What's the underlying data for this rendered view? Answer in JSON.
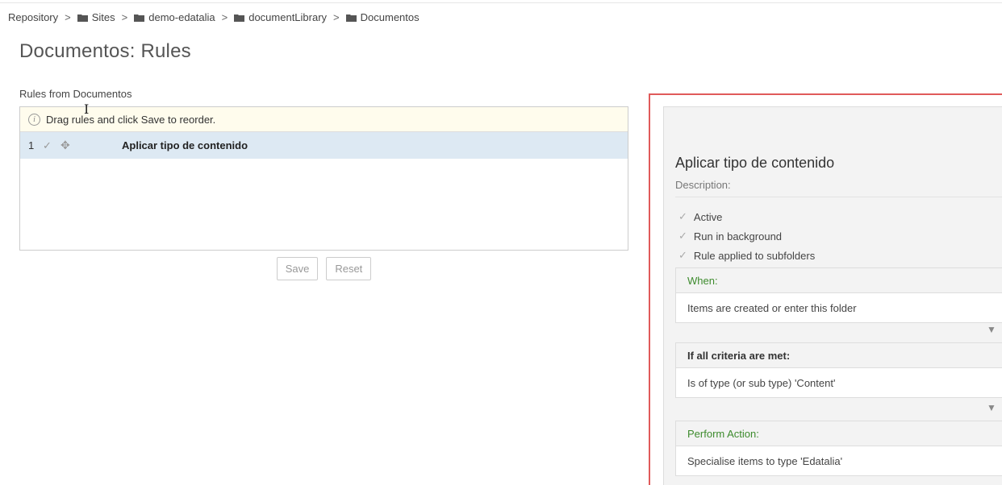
{
  "breadcrumb": {
    "root": "Repository",
    "separator": ">",
    "items": [
      "Sites",
      "demo-edatalia",
      "documentLibrary",
      "Documentos"
    ]
  },
  "page_title": "Documentos: Rules",
  "rules_list": {
    "heading": "Rules from Documentos",
    "hint": "Drag rules and click Save to reorder.",
    "rows": [
      {
        "index": "1",
        "name": "Aplicar tipo de contenido"
      }
    ],
    "save_label": "Save",
    "reset_label": "Reset"
  },
  "rule_detail": {
    "title": "Aplicar tipo de contenido",
    "description_label": "Description:",
    "flags": [
      "Active",
      "Run in background",
      "Rule applied to subfolders"
    ],
    "when_label": "When:",
    "when_value": "Items are created or enter this folder",
    "criteria_label": "If all criteria are met:",
    "criteria_value": "Is of type (or sub type) 'Content'",
    "action_label": "Perform Action:",
    "action_value": "Specialise items to type 'Edatalia'"
  },
  "colors": {
    "selected_row": "#dde9f3",
    "hint_background": "#fffced",
    "section_green": "#3d8b2d",
    "highlight_border": "#e05a5a"
  }
}
